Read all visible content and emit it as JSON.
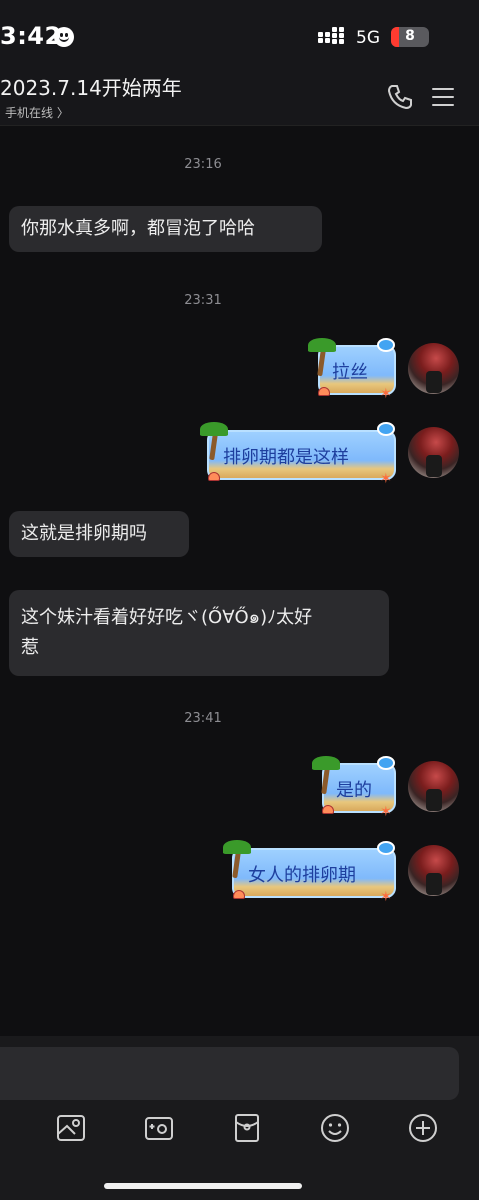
{
  "status_bar": {
    "time": "3:42",
    "network": "5G",
    "battery": "8"
  },
  "header": {
    "title": "2023.7.14开始两年",
    "subtitle": "手机在线 〉"
  },
  "messages": {
    "ts1": "23:16",
    "m1": "你那水真多啊，都冒泡了哈哈",
    "ts2": "23:31",
    "m2": "拉丝",
    "m3": "排卵期都是这样",
    "m4": "这就是排卵期吗",
    "m5_line1": "这个妹汁看着好好吃ヾ(Ő∀Ő๑)ﾉ太好",
    "m5_line2": "惹",
    "ts3": "23:41",
    "m6": "是的",
    "m7": "女人的排卵期"
  },
  "colors": {
    "background": "#0f0f11",
    "incoming_bubble": "#2b2b2e",
    "beach_text": "#1e3f9e",
    "battery_low": "#ff3b30"
  },
  "icons": [
    "smile-icon",
    "signal-icon",
    "battery-icon",
    "phone-icon",
    "menu-icon",
    "palm-icon",
    "image-icon",
    "camera-icon",
    "red-packet-icon",
    "emoji-icon",
    "plus-icon"
  ]
}
